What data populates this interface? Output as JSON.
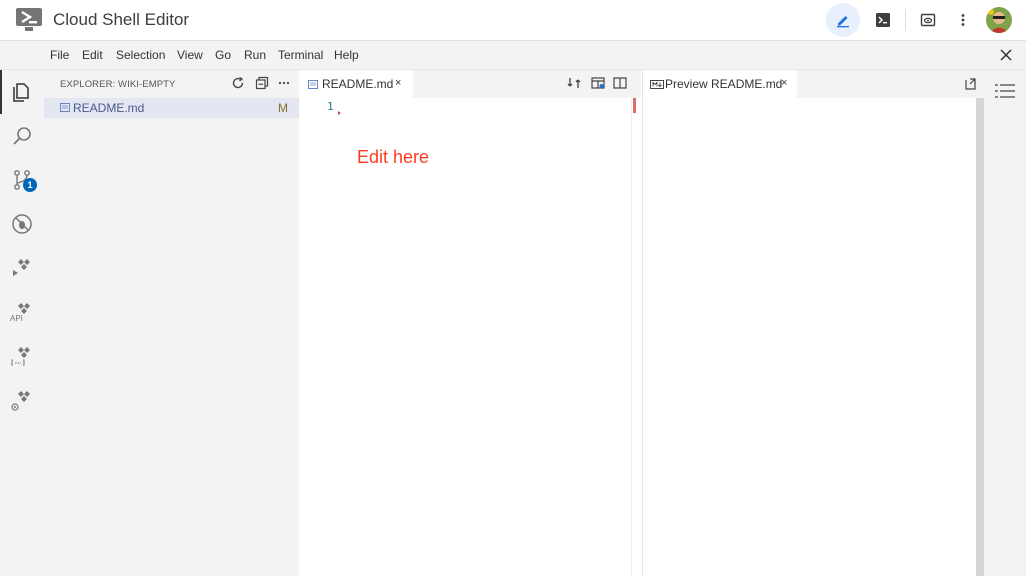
{
  "app": {
    "title": "Cloud Shell Editor"
  },
  "header_icons": [
    "edit-pencil-icon",
    "terminal-icon",
    "web-preview-icon",
    "more-vert-icon",
    "avatar"
  ],
  "menu": {
    "items": [
      "File",
      "Edit",
      "Selection",
      "View",
      "Go",
      "Run",
      "Terminal",
      "Help"
    ]
  },
  "activity_bar": {
    "items": [
      "explorer-icon",
      "search-icon",
      "source-control-icon",
      "run-debug-icon",
      "cloud-run-icon",
      "cloud-api-icon",
      "cloud-code-icon",
      "secret-manager-icon"
    ],
    "source_control_badge": "1",
    "api_label": "API"
  },
  "explorer": {
    "title": "EXPLORER: WIKI-EMPTY",
    "files": [
      {
        "name": "README.md",
        "status": "M"
      }
    ]
  },
  "editor": {
    "tab_label": "README.md",
    "tab_close": "×",
    "line_number": "1",
    "annotation": "Edit here"
  },
  "preview": {
    "tab_label": "Preview README.md",
    "tab_close": "×"
  },
  "colors": {
    "accent": "#1a73e8",
    "annotation": "#ff3b1f",
    "badge": "#0066b8",
    "modified": "#8b6d2a"
  }
}
